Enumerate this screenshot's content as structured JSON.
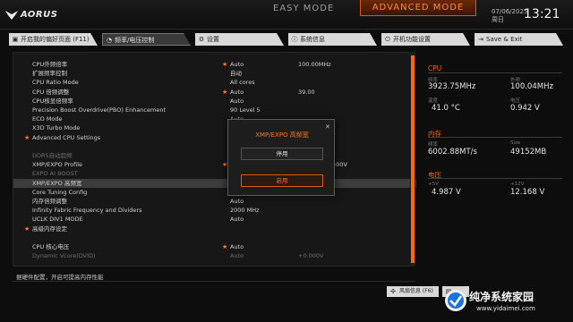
{
  "header": {
    "brand": "AORUS",
    "easy_mode": "EASY MODE",
    "advanced_mode": "ADVANCED MODE",
    "date": "07/06/2025",
    "weekday": "周日",
    "time": "13:21"
  },
  "tabs": [
    {
      "label": "开启我的偏好页面 (F11)",
      "icon": "bookmark-icon"
    },
    {
      "label": "频率/电压控制",
      "icon": "gauge-icon"
    },
    {
      "label": "设置",
      "icon": "gear-icon"
    },
    {
      "label": "系统信息",
      "icon": "info-icon"
    },
    {
      "label": "开机功能设置",
      "icon": "power-icon"
    },
    {
      "label": "Save & Exit",
      "icon": "exit-icon"
    }
  ],
  "settings": [
    {
      "label": "CPU外频倍率",
      "star": true,
      "value": "Auto",
      "value2": "100.00MHz"
    },
    {
      "label": "扩展频率控制",
      "star": false,
      "value": "自动",
      "value2": ""
    },
    {
      "label": "CPU Ratio Mode",
      "star": false,
      "value": "All cores",
      "value2": ""
    },
    {
      "label": "CPU 倍频调整",
      "star": true,
      "value": "Auto",
      "value2": "39.00"
    },
    {
      "label": "CPU核显倍频率",
      "star": false,
      "value": "Auto",
      "value2": ""
    },
    {
      "label": "Precision Boost Overdrive(PBO) Enhancement",
      "star": false,
      "value": "90 Level 5",
      "value2": ""
    },
    {
      "label": "ECO Mode",
      "star": false,
      "value": "Auto",
      "value2": ""
    },
    {
      "label": "X3D Turbo Mode",
      "star": false,
      "value": "Auto",
      "value2": ""
    },
    {
      "label": "Advanced CPU Settings",
      "star": false,
      "value": "",
      "value2": "",
      "bullet": true
    },
    {
      "label": "",
      "star": false,
      "value": "",
      "value2": ""
    },
    {
      "label": "DDR5自动超频",
      "star": false,
      "value": "",
      "value2": "",
      "dim": true
    },
    {
      "label": "XMP/EXPO Profile",
      "star": true,
      "value": "E",
      "value2": "38-38-96-1.400V"
    },
    {
      "label": "EXPO AI BOOST",
      "star": false,
      "value": "",
      "value2": "",
      "dim": true
    },
    {
      "label": "XMP/EXPO 高频宽",
      "star": false,
      "value": "",
      "value2": "",
      "selected": true
    },
    {
      "label": "Core Tuning Config",
      "star": false,
      "value": "",
      "value2": ""
    },
    {
      "label": "内存倍频调整",
      "star": false,
      "value": "Auto",
      "value2": ""
    },
    {
      "label": "Infinity Fabric Frequency and Dividers",
      "star": false,
      "value": "2000 MHz",
      "value2": ""
    },
    {
      "label": "UCLK DIV1 MODE",
      "star": false,
      "value": "Auto",
      "value2": ""
    },
    {
      "label": "高级内存设定",
      "star": false,
      "value": "",
      "value2": "",
      "bullet": true
    },
    {
      "label": "",
      "star": false,
      "value": "",
      "value2": ""
    },
    {
      "label": "CPU 核心电压",
      "star": true,
      "value": "Auto",
      "value2": ""
    },
    {
      "label": "Dynamic Vcore(DVID)",
      "star": false,
      "value": "Auto",
      "value2": "+0.000V",
      "dim": true
    }
  ],
  "help_text": "据硬件配置，开启可提高内存性能",
  "right": {
    "cpu_title": "CPU",
    "freq_label": "频率",
    "freq_value": "3923.75MHz",
    "bclk_label": "外频",
    "bclk_value": "100.04MHz",
    "temp_label": "温度",
    "temp_value": "41.0 °C",
    "volt_label": "电压",
    "volt_value": "0.942 V",
    "mem_title": "内存",
    "mfreq_label": "频率",
    "mfreq_value": "6002.88MT/s",
    "size_label": "Size",
    "size_value": "49152MB",
    "volt_title": "电压",
    "p5_label": "+5V",
    "p5_value": "4.987 V",
    "p12_label": "+12V",
    "p12_value": "12.168 V"
  },
  "bottom": {
    "fan_label": "风扇信息 (F6)"
  },
  "modal": {
    "title": "XMP/EXPO 高频宽",
    "option_off": "停用",
    "option_on": "启用"
  },
  "watermark": {
    "text": "纯净系统家园",
    "url": "www.yidaimei.com"
  },
  "colors": {
    "accent": "#ff6a00",
    "star": "#ff7a1a"
  }
}
